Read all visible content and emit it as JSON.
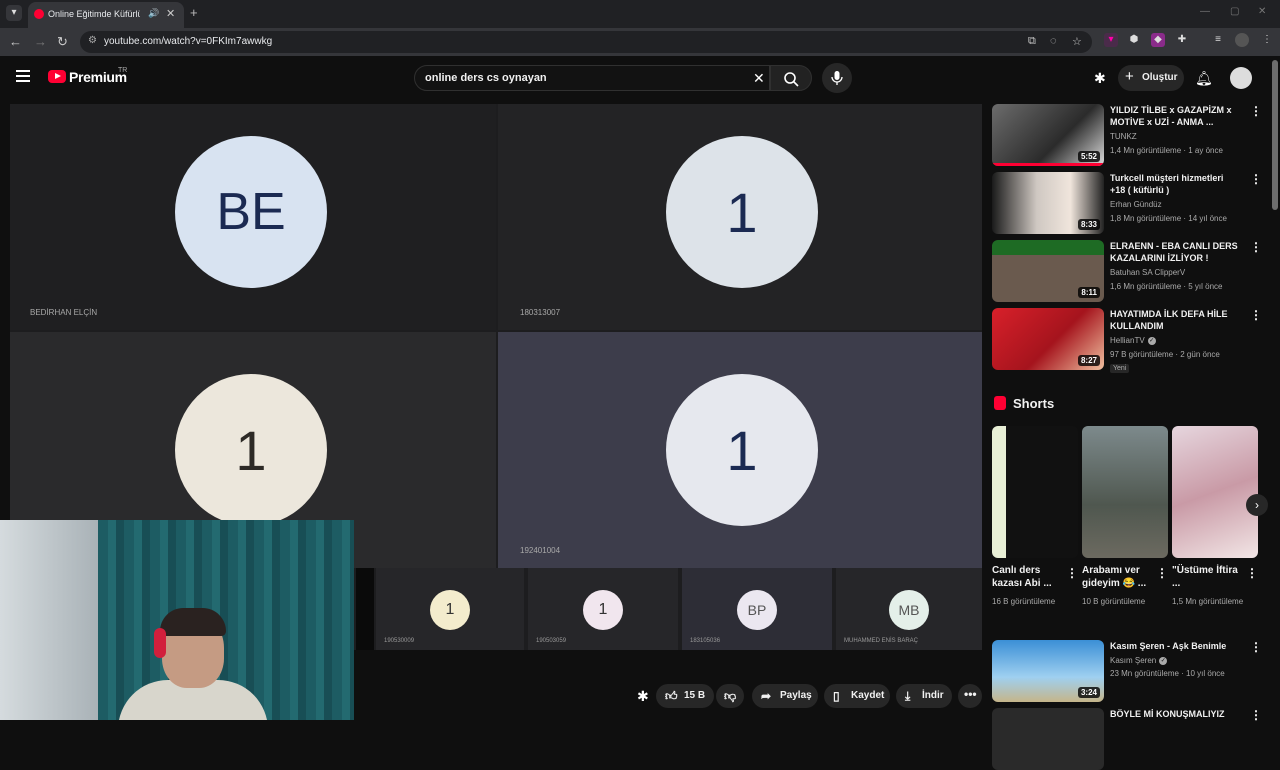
{
  "browser": {
    "tab_title": "Online Eğitimde Küfürlü Cs",
    "new_tab": "+",
    "url": "youtube.com/watch?v=0FKIm7awwkg"
  },
  "header": {
    "logo_text": "Premium",
    "country": "TR",
    "search_query": "online ders cs oynayan",
    "create_label": "Oluştur"
  },
  "video": {
    "tiles": [
      {
        "initials": "BE",
        "name": "BEDİRHAN ELÇİN"
      },
      {
        "initials": "1",
        "name": "180313007"
      },
      {
        "initials": "1",
        "name": ""
      },
      {
        "initials": "1",
        "name": "192401004"
      }
    ],
    "strip": [
      {
        "initials": "1",
        "name": "190530009"
      },
      {
        "initials": "1",
        "name": "190503059"
      },
      {
        "initials": "BP",
        "name": "183105036"
      },
      {
        "initials": "MB",
        "name": "MUHAMMED ENİS BARAÇ"
      }
    ]
  },
  "actions": {
    "likes": "15 B",
    "share": "Paylaş",
    "save": "Kaydet",
    "download": "İndir"
  },
  "sidebar": {
    "videos": [
      {
        "title": "YILDIZ TİLBE x GAZAPİZM x MOTİVE x UZİ - ANMA ...",
        "channel": "TUNKZ",
        "meta": "1,4 Mn görüntüleme · 1 ay önce",
        "duration": "5:52",
        "verified": false,
        "badge": ""
      },
      {
        "title": "Turkcell müşteri hizmetleri +18 ( küfürlü )",
        "channel": "Erhan Gündüz",
        "meta": "1,8 Mn görüntüleme · 14 yıl önce",
        "duration": "8:33",
        "verified": false,
        "badge": ""
      },
      {
        "title": "ELRAENN - EBA CANLI DERS KAZALARINI İZLİYOR !",
        "channel": "Batuhan SA ClipperV",
        "meta": "1,6 Mn görüntüleme · 5 yıl önce",
        "duration": "8:11",
        "verified": false,
        "badge": ""
      },
      {
        "title": "HAYATIMDA İLK DEFA HİLE KULLANDIM",
        "channel": "HellianTV",
        "meta": "97 B görüntüleme · 2 gün önce",
        "duration": "8:27",
        "verified": true,
        "badge": "Yeni"
      }
    ],
    "shorts_heading": "Shorts",
    "shorts": [
      {
        "title": "Canlı ders kazası Abi ...",
        "views": "16 B görüntüleme"
      },
      {
        "title": "Arabamı ver gideyim 😂 ...",
        "views": "10 B görüntüleme"
      },
      {
        "title": "\"Üstüme İftira ...",
        "views": "1,5 Mn görüntüleme"
      }
    ],
    "videos2": [
      {
        "title": "Kasım Şeren - Aşk Benimle",
        "channel": "Kasım Şeren",
        "meta": "23 Mn görüntüleme · 10 yıl önce",
        "duration": "3:24",
        "verified": true
      },
      {
        "title": "BÖYLE Mİ KONUŞMALIYIZ",
        "channel": "",
        "meta": "",
        "duration": "",
        "verified": false
      }
    ]
  }
}
